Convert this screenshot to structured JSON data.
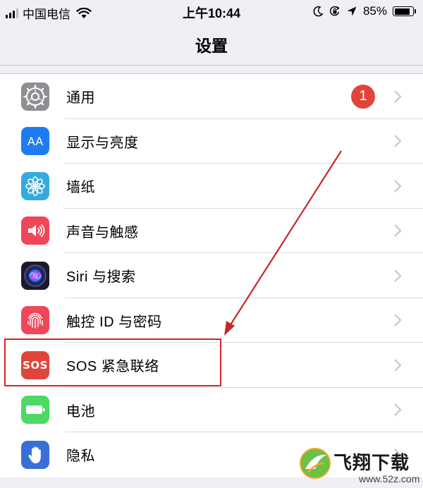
{
  "status_bar": {
    "carrier": "中国电信",
    "time": "上午10:44",
    "battery_percent": "85%",
    "battery_level": 0.85
  },
  "nav": {
    "title": "设置"
  },
  "settings_items": [
    {
      "label": "通用",
      "icon": "gear-icon",
      "color": "#8e8e93",
      "badge": "1"
    },
    {
      "label": "显示与亮度",
      "icon": "text-size-icon",
      "icon_text": "AA",
      "color": "#1f7cf0"
    },
    {
      "label": "墙纸",
      "icon": "flower-icon",
      "color": "#36aadc"
    },
    {
      "label": "声音与触感",
      "icon": "speaker-icon",
      "color": "#f0465a"
    },
    {
      "label": "Siri 与搜索",
      "icon": "siri-icon",
      "color": "#1a1a2e"
    },
    {
      "label": "触控 ID 与密码",
      "icon": "fingerprint-icon",
      "color": "#f0465a"
    },
    {
      "label": "SOS 紧急联络",
      "icon": "sos-icon",
      "icon_text": "SOS",
      "color": "#e0453a"
    },
    {
      "label": "电池",
      "icon": "battery-icon",
      "color": "#4cd964"
    },
    {
      "label": "隐私",
      "icon": "hand-icon",
      "color": "#3a6fd8"
    }
  ],
  "watermark": {
    "title": "飞翔下载",
    "url": "www.52z.com"
  }
}
